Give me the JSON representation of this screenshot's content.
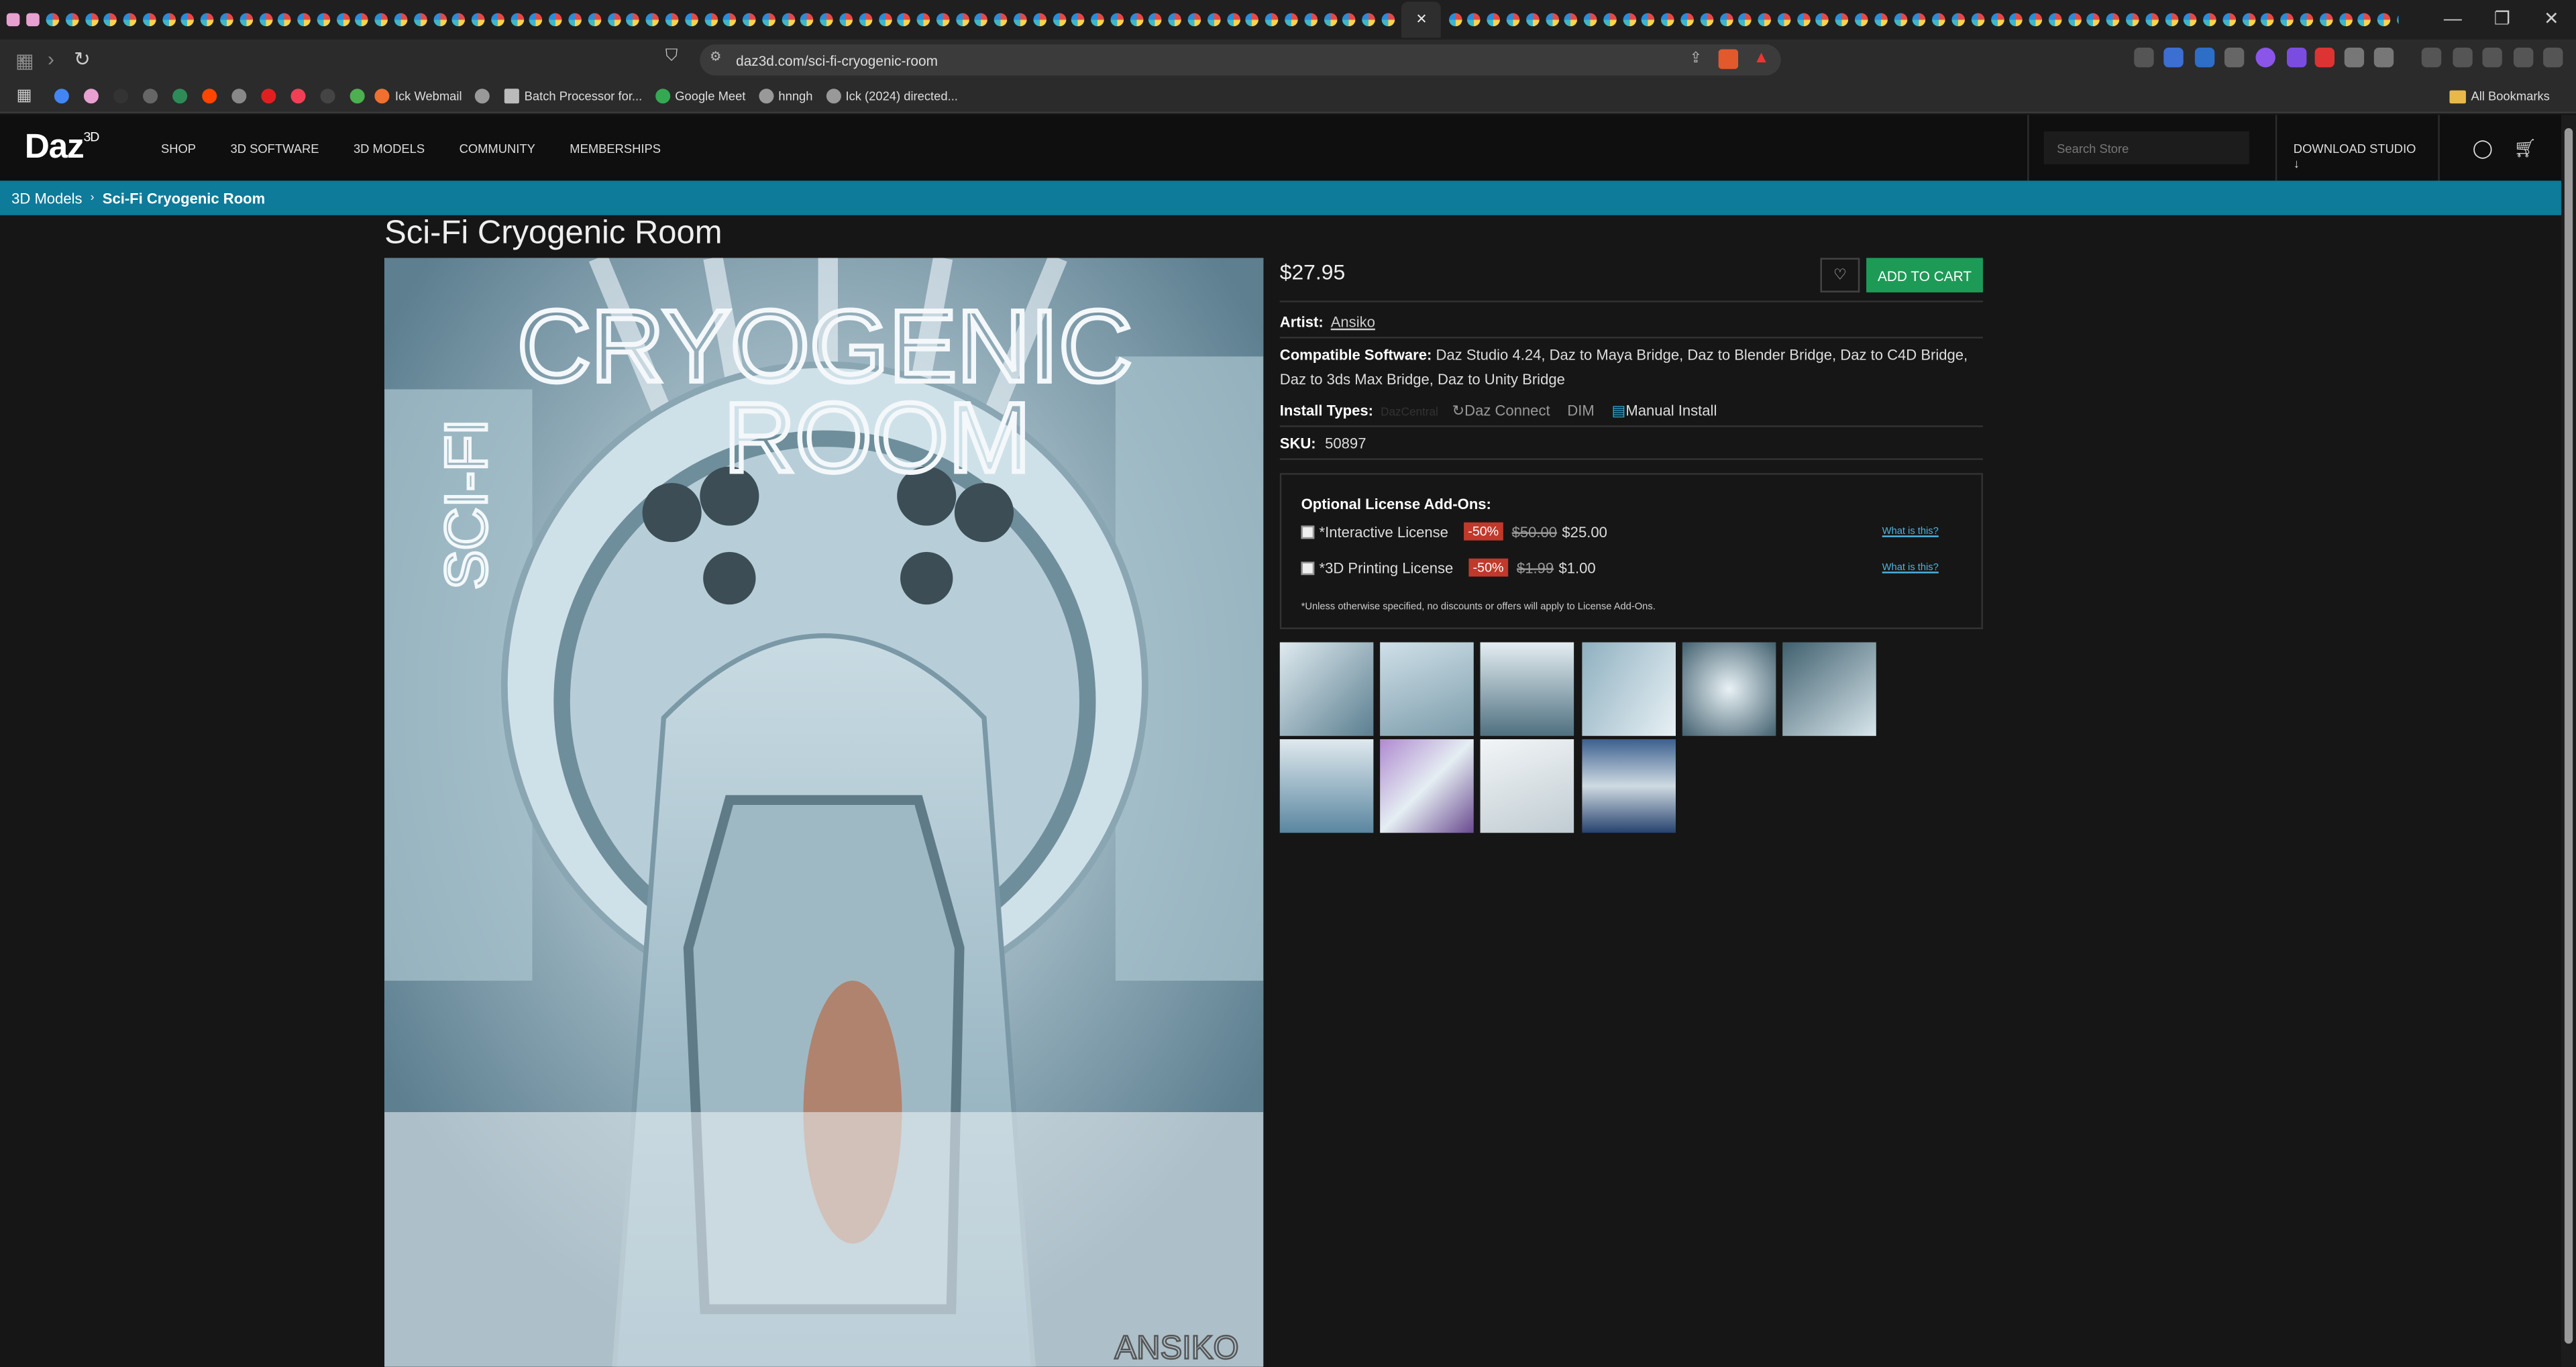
{
  "browser": {
    "active_tab_close": "×",
    "new_tab": "+",
    "url": "daz3d.com/sci-fi-cryogenic-room",
    "bookmarks": [
      "Ick Webmail",
      "Batch Processor for...",
      "Google Meet",
      "hnngh",
      "Ick (2024) directed..."
    ],
    "all_bookmarks": "All Bookmarks"
  },
  "site": {
    "logo": "Daz",
    "logo_sup": "3D",
    "nav": [
      "SHOP",
      "3D SOFTWARE",
      "3D MODELS",
      "COMMUNITY",
      "MEMBERSHIPS"
    ],
    "search_placeholder": "Search Store",
    "download": "DOWNLOAD STUDIO ↓"
  },
  "breadcrumb": {
    "parent": "3D Models",
    "sep": "›",
    "current": "Sci-Fi Cryogenic Room"
  },
  "product": {
    "title": "Sci-Fi Cryogenic Room",
    "price": "$27.95",
    "add_to_cart": "ADD TO CART",
    "artist_label": "Artist:",
    "artist": "Ansiko",
    "software_label": "Compatible Software:",
    "software": "Daz Studio 4.24, Daz to Maya Bridge, Daz to Blender Bridge, Daz to C4D Bridge, Daz to 3ds Max Bridge, Daz to Unity Bridge",
    "install_label": "Install Types:",
    "install_types": [
      "DazCentral",
      "Daz Connect",
      "DIM",
      "Manual Install"
    ],
    "sku_label": "SKU:",
    "sku": "50897",
    "image_title_line1": "CRYOGENIC",
    "image_title_line2": "ROOM",
    "image_title_vertical": "SCI-FI",
    "image_signature": "ANSIKO"
  },
  "license": {
    "heading": "Optional License Add-Ons:",
    "items": [
      {
        "name": "*Interactive License",
        "discount": "-50%",
        "old": "$50.00",
        "new": "$25.00",
        "link": "What is this?"
      },
      {
        "name": "*3D Printing License",
        "discount": "-50%",
        "old": "$1.99",
        "new": "$1.00",
        "link": "What is this?"
      }
    ],
    "note": "*Unless otherwise specified, no discounts or offers will apply to License Add-Ons."
  },
  "colors": {
    "accent": "#0d7b99",
    "cart": "#1e9a57",
    "discount": "#c0392b"
  }
}
